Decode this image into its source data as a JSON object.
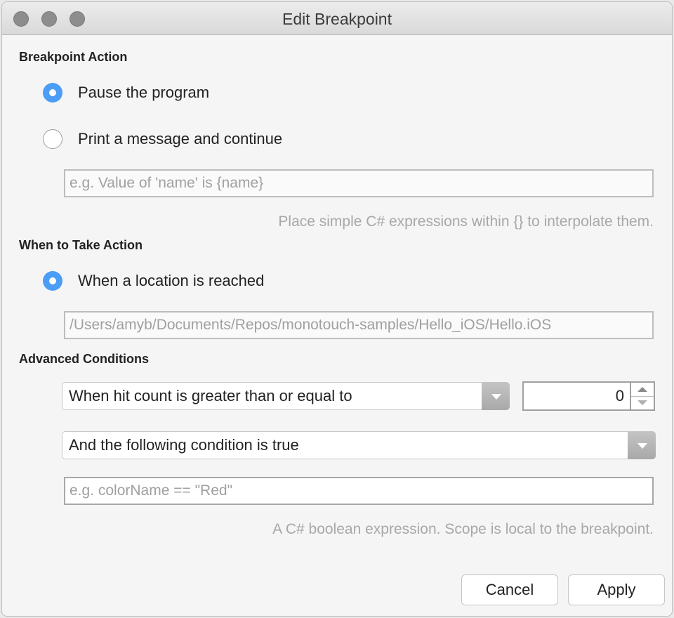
{
  "window": {
    "title": "Edit Breakpoint"
  },
  "breakpoint_action": {
    "heading": "Breakpoint Action",
    "options": [
      {
        "label": "Pause the program",
        "selected": true
      },
      {
        "label": "Print a message and continue",
        "selected": false
      }
    ],
    "message_placeholder": "e.g. Value of 'name' is {name}",
    "message_hint": "Place simple C# expressions within {} to interpolate them."
  },
  "when_to_take_action": {
    "heading": "When to Take Action",
    "option": {
      "label": "When a location is reached",
      "selected": true
    },
    "location_value": "/Users/amyb/Documents/Repos/monotouch-samples/Hello_iOS/Hello.iOS"
  },
  "advanced_conditions": {
    "heading": "Advanced Conditions",
    "hit_count_select": "When hit count is greater than or equal to",
    "hit_count_value": "0",
    "condition_select": "And the following condition is true",
    "condition_placeholder": "e.g. colorName == \"Red\"",
    "condition_hint": "A C# boolean expression. Scope is local to the breakpoint."
  },
  "buttons": {
    "cancel": "Cancel",
    "apply": "Apply"
  },
  "colors": {
    "accent": "#4b9df5"
  }
}
